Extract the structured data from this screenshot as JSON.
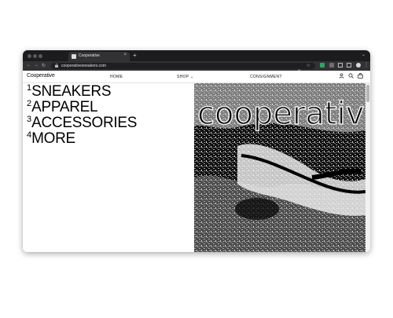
{
  "browser": {
    "tab": {
      "title": "Cooperative",
      "close": "×"
    },
    "new_tab": "+",
    "tab_menu": "⌄",
    "address": {
      "url": "cooperativesneakers.com"
    }
  },
  "site": {
    "logo": "Cooperative",
    "menu": [
      {
        "label": "HOME"
      },
      {
        "label": "SHOP ⌄"
      },
      {
        "label": "CONSIGNMENT"
      }
    ]
  },
  "categories": [
    {
      "num": "1",
      "label": "SNEAKERS"
    },
    {
      "num": "2",
      "label": "APPAREL"
    },
    {
      "num": "3",
      "label": "ACCESSORIES"
    },
    {
      "num": "4",
      "label": "MORE"
    }
  ],
  "hero": {
    "graffiti_text": "cooperative"
  },
  "colors": {
    "chrome_dark": "#1c1c1e",
    "toolbar": "#323234",
    "text": "#000000",
    "extension_green": "#2fa36b"
  },
  "icons": [
    "back-icon",
    "forward-icon",
    "reload-icon",
    "lock-icon",
    "share-icon",
    "bookmark-star-icon",
    "extension-icon",
    "puzzle-icon",
    "sidebar-icon",
    "profile-icon",
    "user-icon",
    "search-icon",
    "cart-icon"
  ]
}
